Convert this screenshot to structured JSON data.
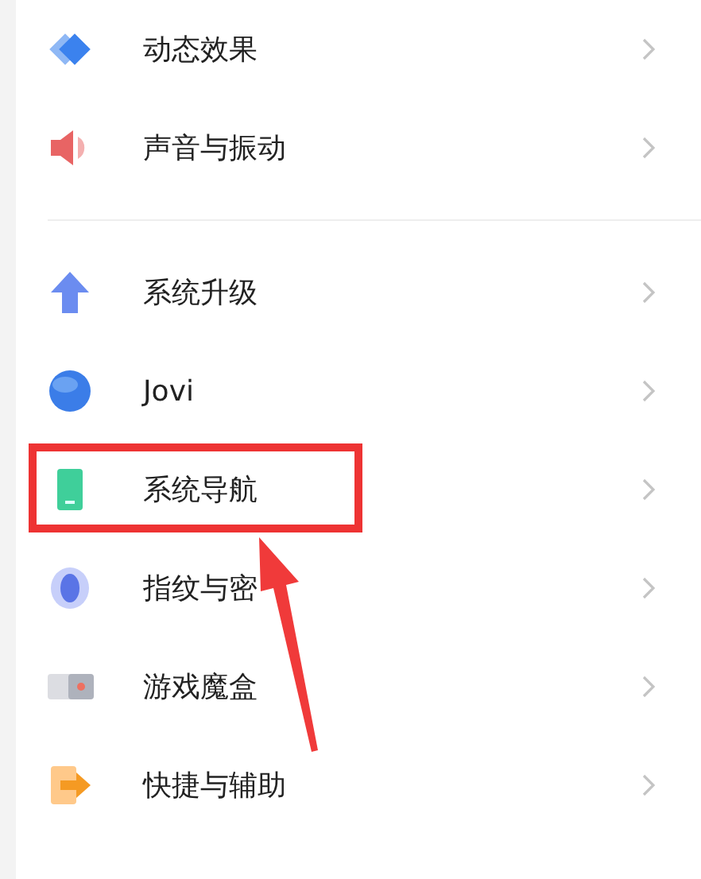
{
  "sections": [
    {
      "items": [
        {
          "kind": "layers",
          "label": "动态效果",
          "highlighted": false
        },
        {
          "kind": "speaker",
          "label": "声音与振动",
          "highlighted": false
        }
      ]
    },
    {
      "items": [
        {
          "kind": "upgrade",
          "label": "系统升级",
          "highlighted": false
        },
        {
          "kind": "assistant",
          "label": "Jovi",
          "highlighted": false
        },
        {
          "kind": "phone",
          "label": "系统导航",
          "highlighted": true
        },
        {
          "kind": "fingerprint",
          "label": "指纹与密",
          "highlighted": false
        },
        {
          "kind": "game",
          "label": "游戏魔盒",
          "highlighted": false
        },
        {
          "kind": "shortcut",
          "label": "快捷与辅助",
          "highlighted": false
        }
      ]
    }
  ]
}
